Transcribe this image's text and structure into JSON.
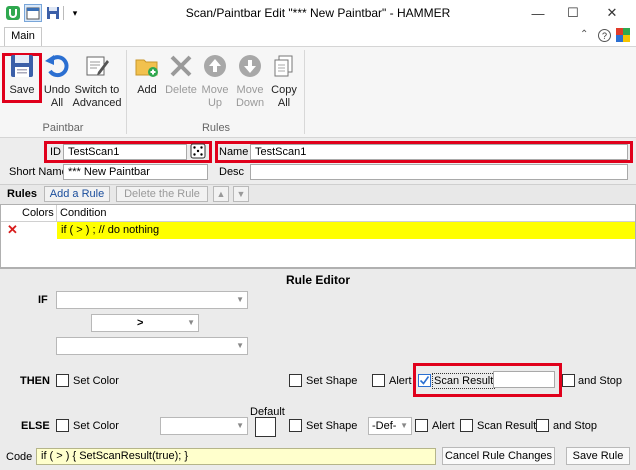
{
  "window": {
    "title": "Scan/Paintbar Edit \"*** New Paintbar\" - HAMMER",
    "minimize": "—",
    "maximize": "☐",
    "close": "✕"
  },
  "tabs": {
    "main": "Main"
  },
  "ribbon": {
    "save": "Save",
    "undo_all": "Undo\nAll",
    "switch_advanced": "Switch to\nAdvanced",
    "add": "Add",
    "delete": "Delete",
    "move_up": "Move\nUp",
    "move_down": "Move\nDown",
    "copy_all": "Copy\nAll",
    "group_paintbar": "Paintbar",
    "group_rules": "Rules"
  },
  "props": {
    "id_label": "ID",
    "id_value": "TestScan1",
    "name_label": "Name",
    "name_value": "TestScan1",
    "short_name_label": "Short Name",
    "short_name_value": "*** New Paintbar",
    "desc_label": "Desc",
    "desc_value": ""
  },
  "rules": {
    "label": "Rules",
    "add_rule": "Add a Rule",
    "delete_rule": "Delete the Rule",
    "col_colors": "Colors",
    "col_condition": "Condition",
    "rows": [
      {
        "condition": "if ( > )   ; // do nothing"
      }
    ]
  },
  "editor": {
    "title": "Rule Editor",
    "if_label": "IF",
    "operator": ">",
    "then_label": "THEN",
    "else_label": "ELSE",
    "set_color": "Set Color",
    "set_shape": "Set Shape",
    "alert": "Alert",
    "scan_result": "Scan Result",
    "and_stop": "and Stop",
    "default_label": "Default",
    "def_option": "-Def-",
    "code_label": "Code",
    "code_value": "if ( > )  {  SetScanResult(true); }",
    "cancel_changes": "Cancel Rule Changes",
    "save_rule": "Save Rule"
  },
  "colors": {
    "highlight_red": "#e0001b",
    "row_yellow": "#ffff00",
    "code_bg": "#ffffcc",
    "ribbon_blue": "#2b579a"
  }
}
